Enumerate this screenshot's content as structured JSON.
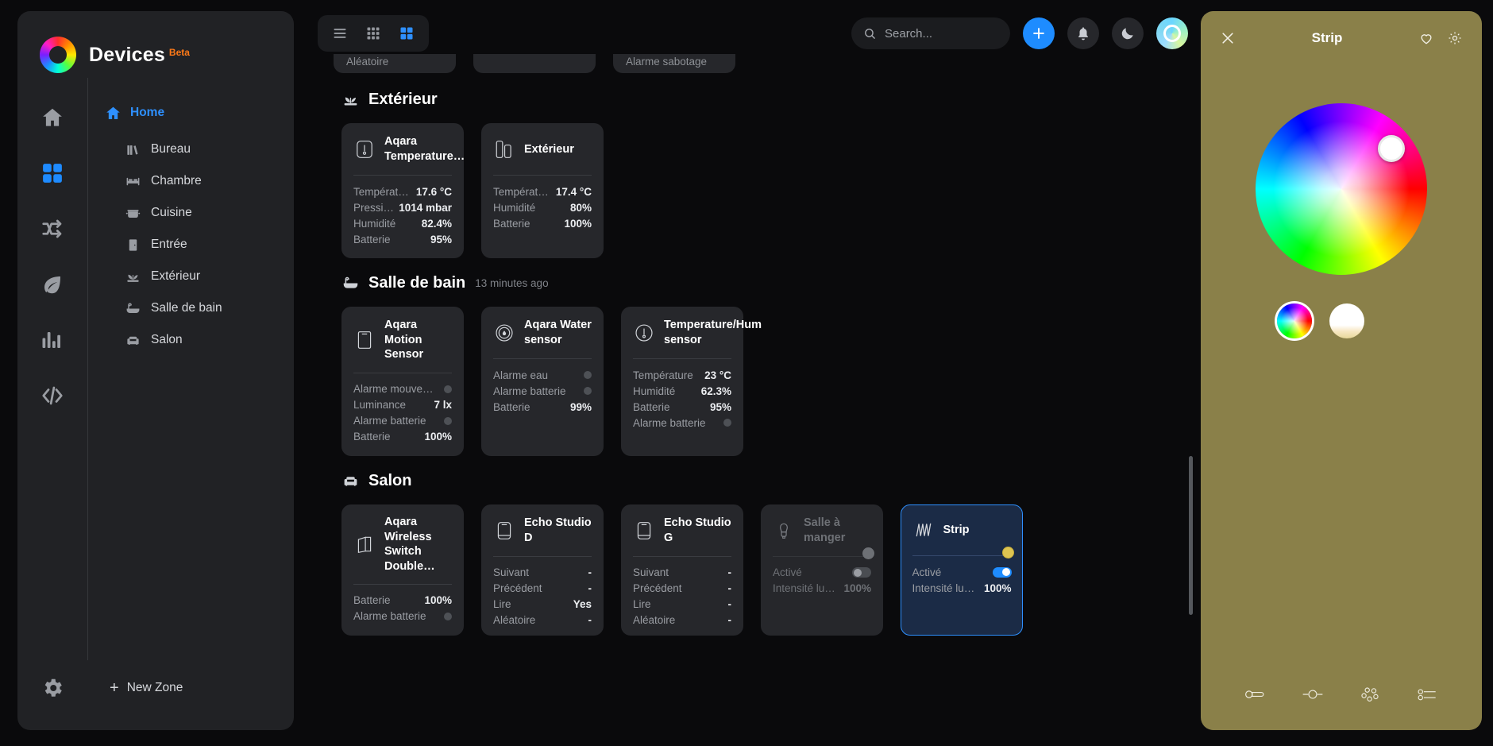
{
  "brand": {
    "title": "Devices",
    "badge": "Beta"
  },
  "rail": [
    {
      "name": "home",
      "icon": "home-icon",
      "active": false
    },
    {
      "name": "devices",
      "icon": "grid-icon",
      "active": true
    },
    {
      "name": "automations",
      "icon": "shuffle-icon",
      "active": false
    },
    {
      "name": "energy",
      "icon": "leaf-icon",
      "active": false
    },
    {
      "name": "statistics",
      "icon": "bar-chart-icon",
      "active": false
    },
    {
      "name": "code",
      "icon": "code-icon",
      "active": false
    }
  ],
  "zones": {
    "home_label": "Home",
    "items": [
      {
        "label": "Bureau",
        "icon": "books-icon"
      },
      {
        "label": "Chambre",
        "icon": "bed-icon"
      },
      {
        "label": "Cuisine",
        "icon": "pot-icon"
      },
      {
        "label": "Entrée",
        "icon": "door-icon"
      },
      {
        "label": "Extérieur",
        "icon": "plant-icon"
      },
      {
        "label": "Salle de bain",
        "icon": "bathtub-icon"
      },
      {
        "label": "Salon",
        "icon": "sofa-icon"
      }
    ],
    "new_zone_label": "New Zone"
  },
  "topbar": {
    "view_modes": [
      {
        "name": "list-view",
        "icon": "list-icon",
        "active": false
      },
      {
        "name": "small-grid-view",
        "icon": "small-grid-icon",
        "active": false
      },
      {
        "name": "large-grid-view",
        "icon": "large-grid-icon",
        "active": true
      }
    ],
    "search_placeholder": "Search...",
    "search_value": "",
    "add_label": "+",
    "buttons": [
      "add-button",
      "notifications-button",
      "dark-mode-button",
      "avatar-button"
    ]
  },
  "clipped_cards": [
    {
      "text": "Aléatoire"
    },
    {
      "text": ""
    },
    {
      "text": "Alarme sabotage"
    }
  ],
  "sections": [
    {
      "title": "Extérieur",
      "icon": "plant-icon",
      "subtitle": "",
      "cards": [
        {
          "title": "Aqara Temperature…",
          "icon": "thermometer-icon",
          "state": "on",
          "rows": [
            {
              "label": "Température",
              "value": "17.6 °C"
            },
            {
              "label": "Pression",
              "value": "1014 mbar"
            },
            {
              "label": "Humidité",
              "value": "82.4%"
            },
            {
              "label": "Batterie",
              "value": "95%"
            }
          ]
        },
        {
          "title": "Extérieur",
          "icon": "contact-sensor-icon",
          "state": "on",
          "rows": [
            {
              "label": "Température",
              "value": "17.4 °C"
            },
            {
              "label": "Humidité",
              "value": "80%"
            },
            {
              "label": "Batterie",
              "value": "100%"
            }
          ]
        }
      ]
    },
    {
      "title": "Salle de bain",
      "icon": "bathtub-icon",
      "subtitle": "13 minutes ago",
      "cards": [
        {
          "title": "Aqara Motion Sensor",
          "icon": "motion-sensor-icon",
          "state": "on",
          "rows": [
            {
              "label": "Alarme mouvement",
              "value": "",
              "dot": true
            },
            {
              "label": "Luminance",
              "value": "7 lx"
            },
            {
              "label": "Alarme batterie",
              "value": "",
              "dot": true
            },
            {
              "label": "Batterie",
              "value": "100%"
            }
          ]
        },
        {
          "title": "Aqara Water sensor",
          "icon": "water-sensor-icon",
          "state": "on",
          "rows": [
            {
              "label": "Alarme eau",
              "value": "",
              "dot": true
            },
            {
              "label": "Alarme batterie",
              "value": "",
              "dot": true
            },
            {
              "label": "Batterie",
              "value": "99%"
            }
          ]
        },
        {
          "title": "Temperature/Hum sensor",
          "icon": "thermometer-icon",
          "state": "on",
          "rows": [
            {
              "label": "Température",
              "value": "23 °C"
            },
            {
              "label": "Humidité",
              "value": "62.3%"
            },
            {
              "label": "Batterie",
              "value": "95%"
            },
            {
              "label": "Alarme batterie",
              "value": "",
              "dot": true
            }
          ]
        }
      ]
    },
    {
      "title": "Salon",
      "icon": "sofa-icon",
      "subtitle": "",
      "cards": [
        {
          "title": "Aqara Wireless Switch Double…",
          "icon": "switch-icon",
          "state": "on",
          "rows": [
            {
              "label": "Batterie",
              "value": "100%"
            },
            {
              "label": "Alarme batterie",
              "value": "",
              "dot": true
            }
          ]
        },
        {
          "title": "Echo Studio D",
          "icon": "speaker-icon",
          "state": "on",
          "rows": [
            {
              "label": "Suivant",
              "value": "-"
            },
            {
              "label": "Précédent",
              "value": "-"
            },
            {
              "label": "Lire",
              "value": "Yes"
            },
            {
              "label": "Aléatoire",
              "value": "-"
            }
          ]
        },
        {
          "title": "Echo Studio G",
          "icon": "speaker-icon",
          "state": "on",
          "rows": [
            {
              "label": "Suivant",
              "value": "-"
            },
            {
              "label": "Précédent",
              "value": "-"
            },
            {
              "label": "Lire",
              "value": "-"
            },
            {
              "label": "Aléatoire",
              "value": "-"
            }
          ]
        },
        {
          "title": "Salle à manger",
          "icon": "bulb-icon",
          "state": "off",
          "badge": "grey",
          "rows": [
            {
              "label": "Activé",
              "value": "",
              "toggle": "off"
            },
            {
              "label": "Intensité lumineu…",
              "value": "100%"
            }
          ]
        },
        {
          "title": "Strip",
          "icon": "strip-icon",
          "state": "on",
          "selected": true,
          "badge": "amber",
          "rows": [
            {
              "label": "Activé",
              "value": "",
              "toggle": "on"
            },
            {
              "label": "Intensité lumineu…",
              "value": "100%"
            }
          ]
        }
      ]
    }
  ],
  "panel": {
    "title": "Strip",
    "background_color": "#8a8049",
    "close_icon": "close-icon",
    "favorite_icon": "heart-icon",
    "settings_icon": "gear-icon",
    "wheel": {
      "name": "color-wheel",
      "knob_label": ""
    },
    "swatches": [
      {
        "name": "color-mode-swatch",
        "type": "color",
        "selected": true
      },
      {
        "name": "white-mode-swatch",
        "type": "white",
        "selected": false
      }
    ],
    "footer_buttons": [
      {
        "name": "brightness-slider-icon"
      },
      {
        "name": "temperature-slider-icon"
      },
      {
        "name": "scenes-icon"
      },
      {
        "name": "settings-list-icon"
      }
    ]
  }
}
